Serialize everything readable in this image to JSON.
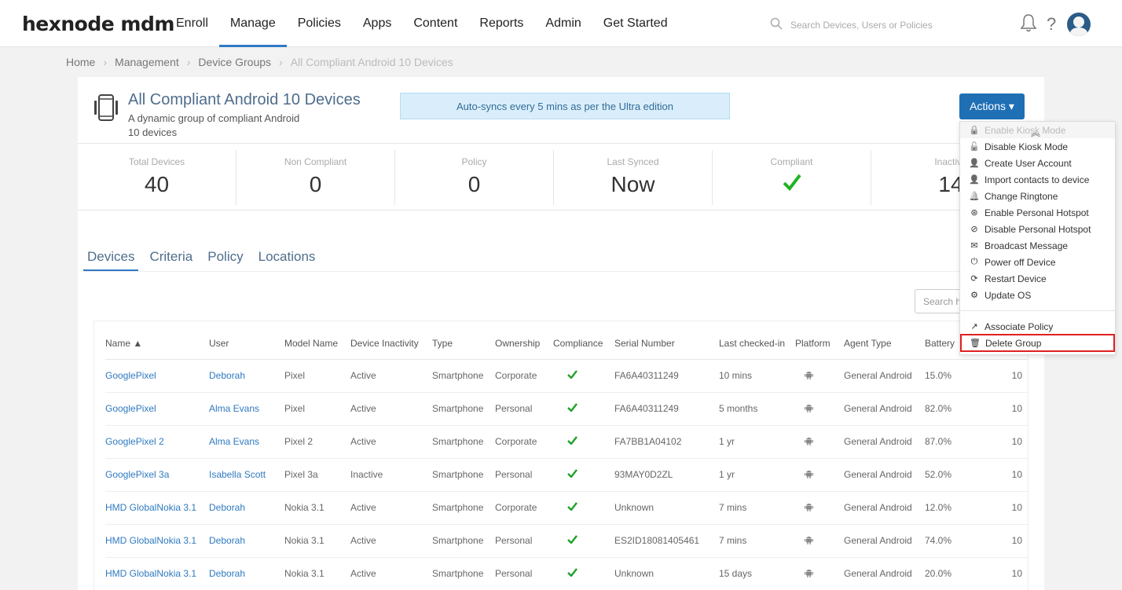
{
  "app": {
    "logo": "hexnode mdm"
  },
  "nav": [
    {
      "label": "Enroll",
      "active": false
    },
    {
      "label": "Manage",
      "active": true
    },
    {
      "label": "Policies",
      "active": false
    },
    {
      "label": "Apps",
      "active": false
    },
    {
      "label": "Content",
      "active": false
    },
    {
      "label": "Reports",
      "active": false
    },
    {
      "label": "Admin",
      "active": false
    },
    {
      "label": "Get Started",
      "active": false
    }
  ],
  "search": {
    "placeholder": "Search Devices, Users or Policies"
  },
  "breadcrumb": [
    "Home",
    "Management",
    "Device Groups",
    "All Compliant Android 10 Devices"
  ],
  "group": {
    "title": "All Compliant Android 10 Devices",
    "subtitle": "A dynamic group of compliant Android 10 devices",
    "sync_note": "Auto-syncs every 5 mins as per the Ultra edition",
    "actions_label": "Actions ▾"
  },
  "stats": [
    {
      "label": "Total Devices",
      "value": "40"
    },
    {
      "label": "Non Compliant",
      "value": "0"
    },
    {
      "label": "Policy",
      "value": "0"
    },
    {
      "label": "Last Synced",
      "value": "Now"
    },
    {
      "label": "Compliant",
      "value": ""
    },
    {
      "label": "Inactive",
      "value": "14"
    }
  ],
  "tabs": [
    {
      "label": "Devices",
      "active": true
    },
    {
      "label": "Criteria",
      "active": false
    },
    {
      "label": "Policy",
      "active": false
    },
    {
      "label": "Locations",
      "active": false
    }
  ],
  "table_search": {
    "placeholder": "Search here"
  },
  "table": {
    "columns": [
      "Name ▲",
      "User",
      "Model Name",
      "Device Inactivity",
      "Type",
      "Ownership",
      "Compliance",
      "Serial Number",
      "Last checked-in",
      "Platform",
      "Agent Type",
      "Battery",
      ""
    ],
    "rows": [
      [
        "GooglePixel",
        "Deborah",
        "Pixel",
        "Active",
        "Smartphone",
        "Corporate",
        "FA6A40311249",
        "10 mins",
        "General Android",
        "15.0%",
        "10"
      ],
      [
        "GooglePixel",
        "Alma Evans",
        "Pixel",
        "Active",
        "Smartphone",
        "Personal",
        "FA6A40311249",
        "5 months",
        "General Android",
        "82.0%",
        "10"
      ],
      [
        "GooglePixel 2",
        "Alma Evans",
        "Pixel 2",
        "Active",
        "Smartphone",
        "Corporate",
        "FA7BB1A04102",
        "1 yr",
        "General Android",
        "87.0%",
        "10"
      ],
      [
        "GooglePixel 3a",
        "Isabella Scott",
        "Pixel 3a",
        "Inactive",
        "Smartphone",
        "Personal",
        "93MAY0D2ZL",
        "1 yr",
        "General Android",
        "52.0%",
        "10"
      ],
      [
        "HMD GlobalNokia 3.1",
        "Deborah",
        "Nokia 3.1",
        "Active",
        "Smartphone",
        "Corporate",
        "Unknown",
        "7 mins",
        "General Android",
        "12.0%",
        "10"
      ],
      [
        "HMD GlobalNokia 3.1",
        "Deborah",
        "Nokia 3.1",
        "Active",
        "Smartphone",
        "Personal",
        "ES2ID18081405461",
        "7 mins",
        "General Android",
        "74.0%",
        "10"
      ],
      [
        "HMD GlobalNokia 3.1",
        "Deborah",
        "Nokia 3.1",
        "Active",
        "Smartphone",
        "Personal",
        "Unknown",
        "15 days",
        "General Android",
        "20.0%",
        "10"
      ]
    ]
  },
  "menu": {
    "items": [
      {
        "label": "Enable Kiosk Mode",
        "icon": "lock-icon",
        "disabled": true
      },
      {
        "label": "Disable Kiosk Mode",
        "icon": "unlock-icon"
      },
      {
        "label": "Create User Account",
        "icon": "add-user-icon"
      },
      {
        "label": "Import contacts to device",
        "icon": "user-icon"
      },
      {
        "label": "Change Ringtone",
        "icon": "bell-icon"
      },
      {
        "label": "Enable Personal Hotspot",
        "icon": "hotspot-icon"
      },
      {
        "label": "Disable Personal Hotspot",
        "icon": "hotspot-off-icon"
      },
      {
        "label": "Broadcast Message",
        "icon": "envelope-icon"
      },
      {
        "label": "Power off Device",
        "icon": "power-icon"
      },
      {
        "label": "Restart Device",
        "icon": "refresh-icon"
      },
      {
        "label": "Update OS",
        "icon": "gears-icon"
      }
    ],
    "items2": [
      {
        "label": "Associate Policy",
        "icon": "share-icon"
      },
      {
        "label": "Delete Group",
        "icon": "trash-icon",
        "highlight": true
      }
    ]
  },
  "colors": {
    "accent": "#1f6fb5",
    "link": "#2f7ac0",
    "check": "#1fa12a",
    "highlight": "#e02020"
  }
}
